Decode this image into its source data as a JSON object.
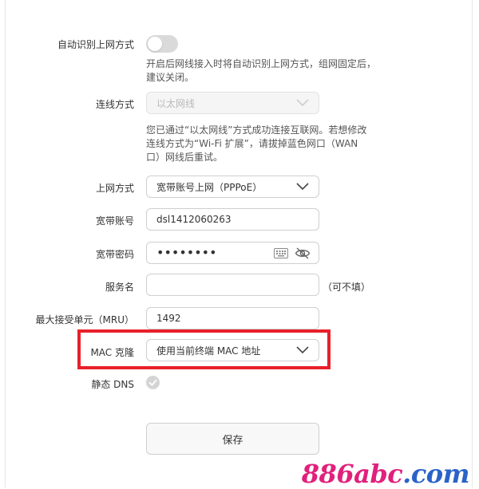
{
  "auto_detect": {
    "label": "自动识别上网方式",
    "hint_line1": "开启后网线接入时将自动识别上网方式，组网固定后，",
    "hint_line2": "建议关闭。",
    "enabled": false
  },
  "connection_mode": {
    "label": "连线方式",
    "value": "以太网线",
    "hint_line1": "您已通过“以太网线”方式成功连接互联网。若想修改",
    "hint_line2": "连线方式为“Wi-Fi 扩展”，请拔掉蓝色网口（WAN",
    "hint_line3": "口）网线后重试。"
  },
  "internet_mode": {
    "label": "上网方式",
    "value": "宽带账号上网（PPPoE）"
  },
  "broadband_account": {
    "label": "宽带账号",
    "value": "dsl1412060263"
  },
  "broadband_password": {
    "label": "宽带密码",
    "masked_value": "••••••••"
  },
  "service_name": {
    "label": "服务名",
    "value": "",
    "suffix": "（可不填）"
  },
  "mru": {
    "label": "最大接受单元（MRU）",
    "value": "1492"
  },
  "mac_clone": {
    "label": "MAC 克隆",
    "value": "使用当前终端 MAC 地址"
  },
  "static_dns": {
    "label": "静态 DNS",
    "enabled": true
  },
  "save_label": "保存",
  "watermark": {
    "part1": "886",
    "part2": "abc",
    "part3": ".com"
  },
  "colors": {
    "highlight": "#e8202a",
    "watermark": "#e0217c"
  }
}
